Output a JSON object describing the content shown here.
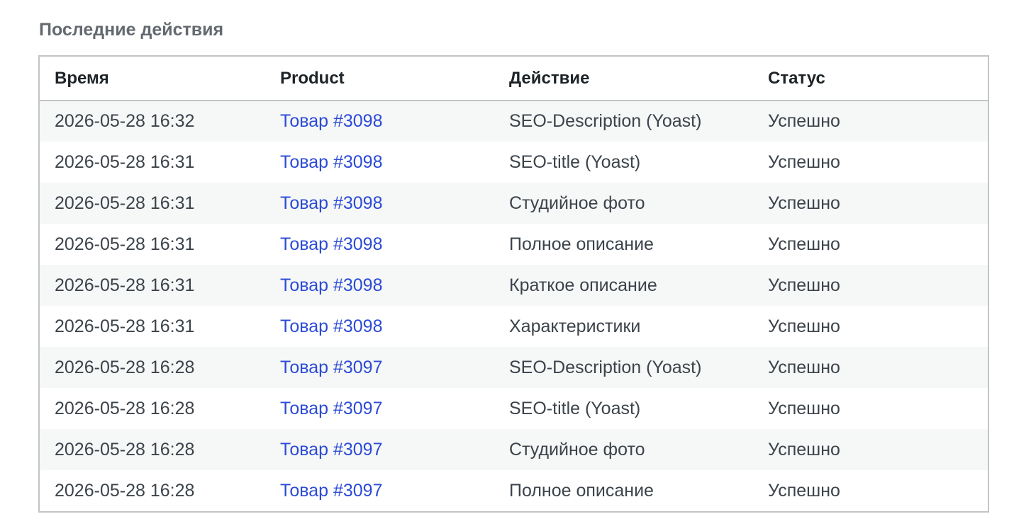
{
  "section": {
    "title": "Последние действия"
  },
  "table": {
    "headers": {
      "time": "Время",
      "product": "Product",
      "action": "Действие",
      "status": "Статус"
    },
    "rows": [
      {
        "time": "2026-05-28 16:32",
        "product": "Товар #3098",
        "action": "SEO-Description (Yoast)",
        "status": "Успешно"
      },
      {
        "time": "2026-05-28 16:31",
        "product": "Товар #3098",
        "action": "SEO-title (Yoast)",
        "status": "Успешно"
      },
      {
        "time": "2026-05-28 16:31",
        "product": "Товар #3098",
        "action": "Студийное фото",
        "status": "Успешно"
      },
      {
        "time": "2026-05-28 16:31",
        "product": "Товар #3098",
        "action": "Полное описание",
        "status": "Успешно"
      },
      {
        "time": "2026-05-28 16:31",
        "product": "Товар #3098",
        "action": "Краткое описание",
        "status": "Успешно"
      },
      {
        "time": "2026-05-28 16:31",
        "product": "Товар #3098",
        "action": "Характеристики",
        "status": "Успешно"
      },
      {
        "time": "2026-05-28 16:28",
        "product": "Товар #3097",
        "action": "SEO-Description (Yoast)",
        "status": "Успешно"
      },
      {
        "time": "2026-05-28 16:28",
        "product": "Товар #3097",
        "action": "SEO-title (Yoast)",
        "status": "Успешно"
      },
      {
        "time": "2026-05-28 16:28",
        "product": "Товар #3097",
        "action": "Студийное фото",
        "status": "Успешно"
      },
      {
        "time": "2026-05-28 16:28",
        "product": "Товар #3097",
        "action": "Полное описание",
        "status": "Успешно"
      }
    ]
  },
  "colors": {
    "link": "#2c4bd6",
    "stripe": "#f6f7f7",
    "border": "#c3c4c7",
    "title": "#646970",
    "header_text": "#1d2327",
    "cell_text": "#3c434a"
  }
}
